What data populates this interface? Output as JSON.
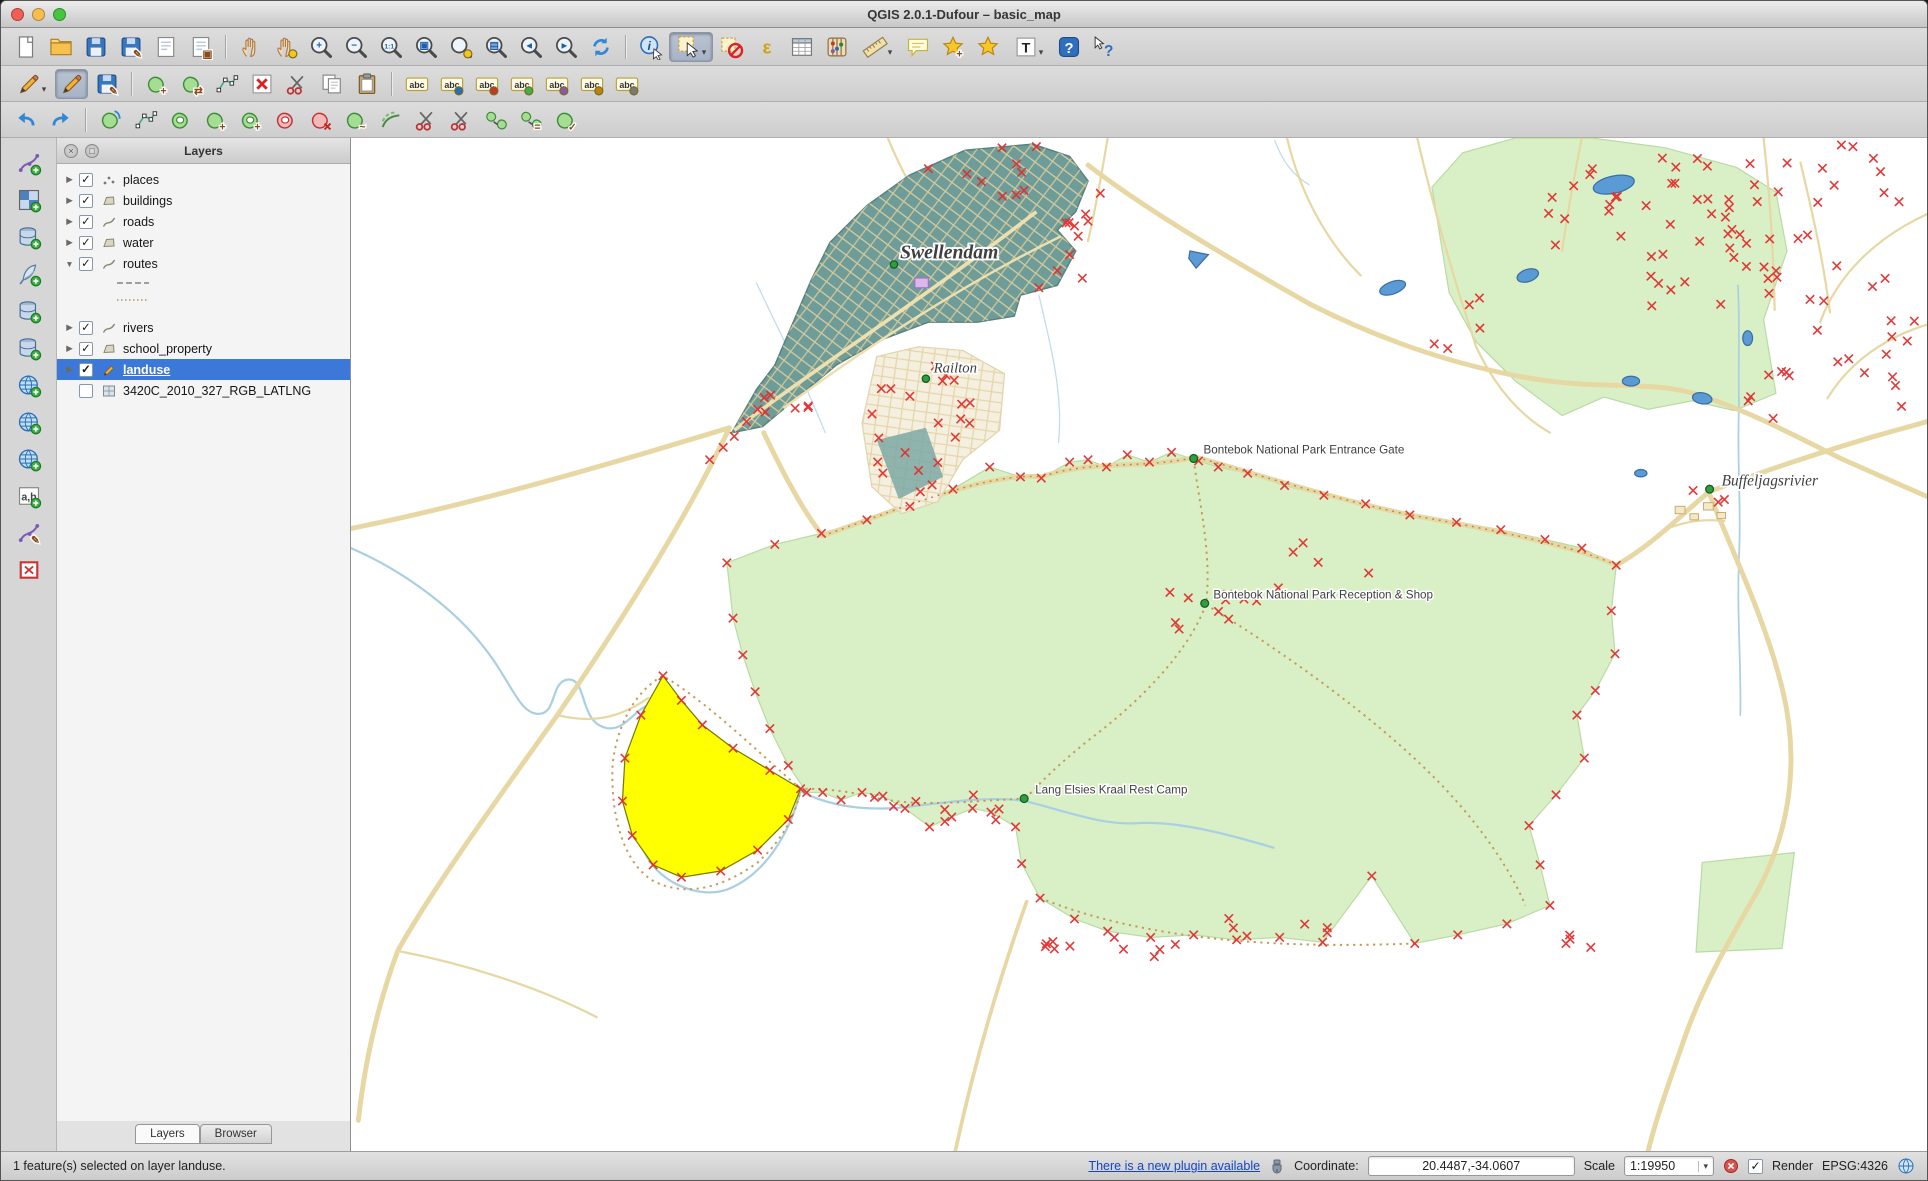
{
  "window": {
    "title": "QGIS 2.0.1-Dufour – basic_map"
  },
  "colors": {
    "selection_blue": "#3c78d8",
    "landuse_selected_fill": "#ffff00",
    "park_green": "#d9f0c6",
    "urban_teal": "#6e9c99",
    "road_tan": "#e7d7a2",
    "marker_red": "#e03030",
    "water_blue": "#5b9bd5"
  },
  "toolbars": {
    "row1": [
      {
        "name": "new-project",
        "kind": "page"
      },
      {
        "name": "open-project",
        "kind": "folder"
      },
      {
        "name": "save-project",
        "kind": "floppy"
      },
      {
        "name": "save-project-as",
        "kind": "floppy",
        "badge": "✎"
      },
      {
        "name": "new-print-composer",
        "kind": "composer"
      },
      {
        "name": "composer-manager",
        "kind": "composer",
        "badge": "▣"
      },
      {
        "sep": true
      },
      {
        "name": "pan-map",
        "kind": "hand"
      },
      {
        "name": "pan-to-selection",
        "kind": "hand",
        "dot": "#f5c518"
      },
      {
        "name": "zoom-in",
        "kind": "magnifier",
        "badge": "+"
      },
      {
        "name": "zoom-out",
        "kind": "magnifier",
        "badge": "−"
      },
      {
        "name": "zoom-native",
        "kind": "magnifier",
        "badge": "1:1"
      },
      {
        "name": "zoom-full",
        "kind": "magnifier",
        "badge": "▣"
      },
      {
        "name": "zoom-to-selection",
        "kind": "magnifier",
        "dot": "#f5c518"
      },
      {
        "name": "zoom-to-layer",
        "kind": "magnifier",
        "badge": "▤"
      },
      {
        "name": "zoom-last",
        "kind": "magnifier",
        "badge": "◂"
      },
      {
        "name": "zoom-next",
        "kind": "magnifier",
        "badge": "▸"
      },
      {
        "name": "refresh-map",
        "kind": "refresh"
      },
      {
        "sep": true
      },
      {
        "name": "identify-features",
        "kind": "identify"
      },
      {
        "name": "select-features",
        "kind": "select",
        "active": true,
        "dropdown": true
      },
      {
        "name": "deselect-features",
        "kind": "deselect"
      },
      {
        "name": "select-by-expression",
        "kind": "epsilon"
      },
      {
        "name": "open-attribute-table",
        "kind": "table"
      },
      {
        "name": "field-calculator",
        "kind": "abacus"
      },
      {
        "name": "measure",
        "kind": "ruler",
        "dropdown": true
      },
      {
        "name": "map-tips",
        "kind": "bubble"
      },
      {
        "name": "new-bookmark",
        "kind": "star",
        "badge": "+"
      },
      {
        "name": "show-bookmarks",
        "kind": "star"
      },
      {
        "name": "text-annotation",
        "kind": "textT",
        "dropdown": true
      },
      {
        "name": "help-contents",
        "kind": "help"
      },
      {
        "name": "whats-this",
        "kind": "whatsthis"
      }
    ],
    "row2": [
      {
        "name": "current-edits",
        "kind": "pencil",
        "dropdown": true
      },
      {
        "name": "toggle-editing",
        "kind": "pencil",
        "active": true
      },
      {
        "name": "save-layer-edits",
        "kind": "floppy",
        "badge": "✎"
      },
      {
        "sep": true
      },
      {
        "name": "add-feature",
        "kind": "blob",
        "badge": "+"
      },
      {
        "name": "move-feature",
        "kind": "blob",
        "badge": "⇄"
      },
      {
        "name": "node-tool",
        "kind": "node"
      },
      {
        "name": "delete-selected",
        "kind": "xsquare"
      },
      {
        "name": "cut-features",
        "kind": "scissors"
      },
      {
        "name": "copy-features",
        "kind": "copy"
      },
      {
        "name": "paste-features",
        "kind": "clipboard"
      },
      {
        "sep": true
      },
      {
        "name": "labeling-options",
        "kind": "abc"
      },
      {
        "name": "pin-labels",
        "kind": "abc",
        "dot": "#2a6db5"
      },
      {
        "name": "highlight-pinned-labels",
        "kind": "abc",
        "dot": "#c0392b"
      },
      {
        "name": "move-label",
        "kind": "abc",
        "dot": "#3faf46"
      },
      {
        "name": "rotate-label",
        "kind": "abc",
        "dot": "#8a5aa8"
      },
      {
        "name": "change-label",
        "kind": "abc",
        "dot": "#b8860b"
      },
      {
        "name": "show-hidden-labels",
        "kind": "abc",
        "dot": "#7a7a7a"
      }
    ],
    "row3": [
      {
        "name": "undo",
        "kind": "undo"
      },
      {
        "name": "redo",
        "kind": "redo"
      },
      {
        "sep": true
      },
      {
        "name": "rotate-feature",
        "kind": "rotate"
      },
      {
        "name": "simplify-feature",
        "kind": "node"
      },
      {
        "name": "add-ring",
        "kind": "ring"
      },
      {
        "name": "add-part",
        "kind": "blob",
        "badge": "+"
      },
      {
        "name": "fill-ring",
        "kind": "ring",
        "badge": "+"
      },
      {
        "name": "delete-ring",
        "kind": "ringred"
      },
      {
        "name": "delete-part",
        "kind": "blobred"
      },
      {
        "name": "reshape-features",
        "kind": "blob",
        "badge": "~"
      },
      {
        "name": "offset-curve",
        "kind": "offset"
      },
      {
        "name": "split-features",
        "kind": "scissors"
      },
      {
        "name": "split-parts",
        "kind": "scissors"
      },
      {
        "name": "merge-features",
        "kind": "merge"
      },
      {
        "name": "merge-attributes",
        "kind": "merge",
        "badge": "="
      },
      {
        "name": "check-geometries",
        "kind": "blob",
        "badge": "✓"
      }
    ],
    "side": [
      {
        "name": "add-vector-layer",
        "kind": "vcurve",
        "plus": true
      },
      {
        "name": "add-raster-layer",
        "kind": "checker",
        "plus": true
      },
      {
        "name": "add-postgis-layer",
        "kind": "db",
        "plus": true
      },
      {
        "name": "add-spatialite-layer",
        "kind": "feather",
        "plus": true
      },
      {
        "name": "add-mssql-layer",
        "kind": "db",
        "plus": true
      },
      {
        "name": "add-oracle-layer",
        "kind": "db",
        "plus": true
      },
      {
        "name": "add-wms-layer",
        "kind": "globe",
        "plus": true
      },
      {
        "name": "add-wcs-layer",
        "kind": "globe",
        "plus": true
      },
      {
        "name": "add-wfs-layer",
        "kind": "globe",
        "plus": true
      },
      {
        "name": "add-delimited-text-layer",
        "kind": "comma",
        "plus": true
      },
      {
        "name": "new-shapefile-layer",
        "kind": "vcurve",
        "badge": "✎"
      },
      {
        "name": "remove-layer",
        "kind": "delsquare"
      }
    ]
  },
  "layers_panel": {
    "title": "Layers",
    "layers": [
      {
        "label": "places",
        "arrow": "right",
        "checked": true,
        "icon": "point"
      },
      {
        "label": "buildings",
        "arrow": "right",
        "checked": true,
        "icon": "polygon"
      },
      {
        "label": "roads",
        "arrow": "right",
        "checked": true,
        "icon": "line"
      },
      {
        "label": "water",
        "arrow": "right",
        "checked": true,
        "icon": "polygon"
      },
      {
        "label": "routes",
        "arrow": "down",
        "checked": true,
        "icon": "line",
        "children": [
          "dashed",
          "dotted"
        ]
      },
      {
        "label": "rivers",
        "arrow": "right",
        "checked": true,
        "icon": "line"
      },
      {
        "label": "school_property",
        "arrow": "right",
        "checked": true,
        "icon": "polygon"
      },
      {
        "label": "landuse",
        "arrow": "right",
        "checked": true,
        "icon": "edit",
        "selected": true
      },
      {
        "label": "3420C_2010_327_RGB_LATLNG",
        "arrow": "none",
        "checked": false,
        "icon": "raster"
      }
    ],
    "tabs": [
      {
        "label": "Layers",
        "active": true
      },
      {
        "label": "Browser",
        "active": false
      }
    ]
  },
  "map": {
    "labels": {
      "swellendam": "Swellendam",
      "railton": "Railton",
      "buffeljagsrivier": "Buffeljagsrivier",
      "entrance_gate": "Bontebok National Park Entrance Gate",
      "reception": "Bontebok National Park Reception & Shop",
      "rest_camp": "Lang Elsies Kraal Rest Camp"
    }
  },
  "status_bar": {
    "message": "1 feature(s) selected on layer landuse.",
    "plugin_link": "There is a new plugin available",
    "coordinate_label": "Coordinate:",
    "coordinate_value": "20.4487,-34.0607",
    "scale_label": "Scale",
    "scale_value": "1:19950",
    "render_label": "Render",
    "render_checked": true,
    "crs_label": "EPSG:4326"
  }
}
